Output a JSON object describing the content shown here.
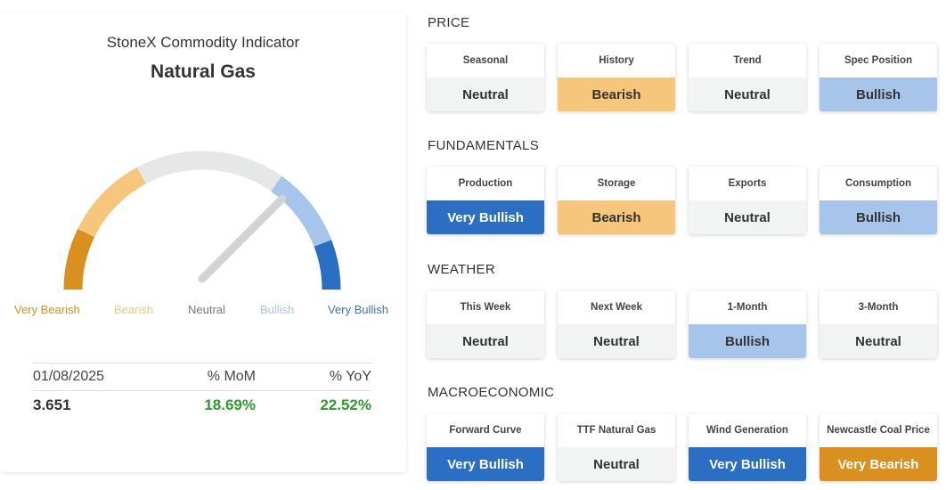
{
  "indicator": {
    "title": "StoneX Commodity Indicator",
    "commodity": "Natural Gas",
    "gauge_labels": [
      "Very Bearish",
      "Bearish",
      "Neutral",
      "Bullish",
      "Very Bullish"
    ],
    "colors": {
      "very_bearish": "#d9901f",
      "bearish": "#f6c67b",
      "neutral": "#e6e7e7",
      "bullish": "#a7c5ea",
      "very_bullish": "#2a6fc4"
    }
  },
  "stats": {
    "headers": [
      "01/08/2025",
      "% MoM",
      "% YoY"
    ],
    "price": "3.651",
    "mom": "18.69%",
    "yoy": "22.52%"
  },
  "sections": [
    {
      "title": "PRICE",
      "tiles": [
        {
          "label": "Seasonal",
          "value": "Neutral",
          "status": "neutral"
        },
        {
          "label": "History",
          "value": "Bearish",
          "status": "bearish"
        },
        {
          "label": "Trend",
          "value": "Neutral",
          "status": "neutral"
        },
        {
          "label": "Spec Position",
          "value": "Bullish",
          "status": "bullish"
        }
      ]
    },
    {
      "title": "FUNDAMENTALS",
      "tiles": [
        {
          "label": "Production",
          "value": "Very Bullish",
          "status": "vbullish"
        },
        {
          "label": "Storage",
          "value": "Bearish",
          "status": "bearish"
        },
        {
          "label": "Exports",
          "value": "Neutral",
          "status": "neutral"
        },
        {
          "label": "Consumption",
          "value": "Bullish",
          "status": "bullish"
        }
      ]
    },
    {
      "title": "WEATHER",
      "tiles": [
        {
          "label": "This Week",
          "value": "Neutral",
          "status": "neutral"
        },
        {
          "label": "Next Week",
          "value": "Neutral",
          "status": "neutral"
        },
        {
          "label": "1-Month",
          "value": "Bullish",
          "status": "bullish"
        },
        {
          "label": "3-Month",
          "value": "Neutral",
          "status": "neutral"
        }
      ]
    },
    {
      "title": "MACROECONOMIC",
      "tiles": [
        {
          "label": "Forward Curve",
          "value": "Very Bullish",
          "status": "vbullish"
        },
        {
          "label": "TTF Natural Gas",
          "value": "Neutral",
          "status": "neutral"
        },
        {
          "label": "Wind Generation",
          "value": "Very Bullish",
          "status": "vbullish"
        },
        {
          "label": "Newcastle Coal Price",
          "value": "Very Bearish",
          "status": "vbearish"
        }
      ]
    }
  ]
}
